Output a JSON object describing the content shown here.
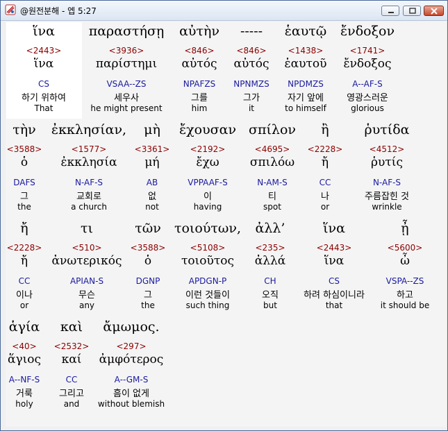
{
  "window": {
    "title": "@원전분해 - 엡 5:27",
    "buttons": {
      "minimize_icon": "minimize-icon",
      "maximize_icon": "maximize-icon",
      "close_icon": "close-icon"
    }
  },
  "words": [
    {
      "greek": "ἵνα",
      "strong": "<2443>",
      "lemma": "ἵνα",
      "parse": "CS",
      "korean": "하기 위하여",
      "english": "That"
    },
    {
      "greek": "παραστήσῃ",
      "strong": "<3936>",
      "lemma": "παρίστημι",
      "parse": "VSAA--ZS",
      "korean": "세우사",
      "english": "he might present"
    },
    {
      "greek": "αὐτὴν",
      "strong": "<846>",
      "lemma": "αὐτός",
      "parse": "NPAFZS",
      "korean": "그를",
      "english": "him"
    },
    {
      "greek": "-----",
      "strong": "<846>",
      "lemma": "αὐτός",
      "parse": "NPNMZS",
      "korean": "그가",
      "english": "it"
    },
    {
      "greek": "ἑαυτῷ",
      "strong": "<1438>",
      "lemma": "ἑαυτοῦ",
      "parse": "NPDMZS",
      "korean": "자기 앞에",
      "english": "to himself"
    },
    {
      "greek": "ἔνδοξον",
      "strong": "<1741>",
      "lemma": "ἔνδοξος",
      "parse": "A--AF-S",
      "korean": "영광스러운",
      "english": "glorious"
    },
    {
      "greek": "τὴν",
      "strong": "<3588>",
      "lemma": "ὁ",
      "parse": "DAFS",
      "korean": "그",
      "english": "the"
    },
    {
      "greek": "ἐκκλησίαν,",
      "strong": "<1577>",
      "lemma": "ἐκκλησία",
      "parse": "N-AF-S",
      "korean": "교회로",
      "english": "a church"
    },
    {
      "greek": "μὴ",
      "strong": "<3361>",
      "lemma": "μή",
      "parse": "AB",
      "korean": "없",
      "english": "not"
    },
    {
      "greek": "ἔχουσαν",
      "strong": "<2192>",
      "lemma": "ἔχω",
      "parse": "VPPAAF-S",
      "korean": "이",
      "english": "having"
    },
    {
      "greek": "σπίλον",
      "strong": "<4695>",
      "lemma": "σπιλόω",
      "parse": "N-AM-S",
      "korean": "티",
      "english": "spot"
    },
    {
      "greek": "ἢ",
      "strong": "<2228>",
      "lemma": "ἤ",
      "parse": "CC",
      "korean": "나",
      "english": "or"
    },
    {
      "greek": "ῥυτίδα",
      "strong": "<4512>",
      "lemma": "ῥυτίς",
      "parse": "N-AF-S",
      "korean": "주름잡힌 것",
      "english": "wrinkle"
    },
    {
      "greek": "ἤ",
      "strong": "<2228>",
      "lemma": "ἤ",
      "parse": "CC",
      "korean": "이나",
      "english": "or"
    },
    {
      "greek": "τι",
      "strong": "<510>",
      "lemma": "ἀνωτερικός",
      "parse": "APIAN-S",
      "korean": "무슨",
      "english": "any"
    },
    {
      "greek": "τῶν",
      "strong": "<3588>",
      "lemma": "ὁ",
      "parse": "DGNP",
      "korean": "그",
      "english": "the"
    },
    {
      "greek": "τοιούτων,",
      "strong": "<5108>",
      "lemma": "τοιοῦτος",
      "parse": "APDGN-P",
      "korean": "이런 것들이",
      "english": "such thing"
    },
    {
      "greek": "ἀλλ’",
      "strong": "<235>",
      "lemma": "ἀλλά",
      "parse": "CH",
      "korean": "오직",
      "english": "but"
    },
    {
      "greek": "ἵνα",
      "strong": "<2443>",
      "lemma": "ἵνα",
      "parse": "CS",
      "korean": "하려 하심이니라",
      "english": "that"
    },
    {
      "greek": "ᾖ",
      "strong": "<5600>",
      "lemma": "ὦ",
      "parse": "VSPA--ZS",
      "korean": "하고",
      "english": "it should be"
    },
    {
      "greek": "ἁγία",
      "strong": "<40>",
      "lemma": "ἅγιος",
      "parse": "A--NF-S",
      "korean": "거룩",
      "english": "holy"
    },
    {
      "greek": "καὶ",
      "strong": "<2532>",
      "lemma": "καί",
      "parse": "CC",
      "korean": "그리고",
      "english": "and"
    },
    {
      "greek": "ἄμωμος.",
      "strong": "<297>",
      "lemma": "ἀμφότερος",
      "parse": "A--GM-S",
      "korean": "흠이 없게",
      "english": "without blemish"
    }
  ]
}
